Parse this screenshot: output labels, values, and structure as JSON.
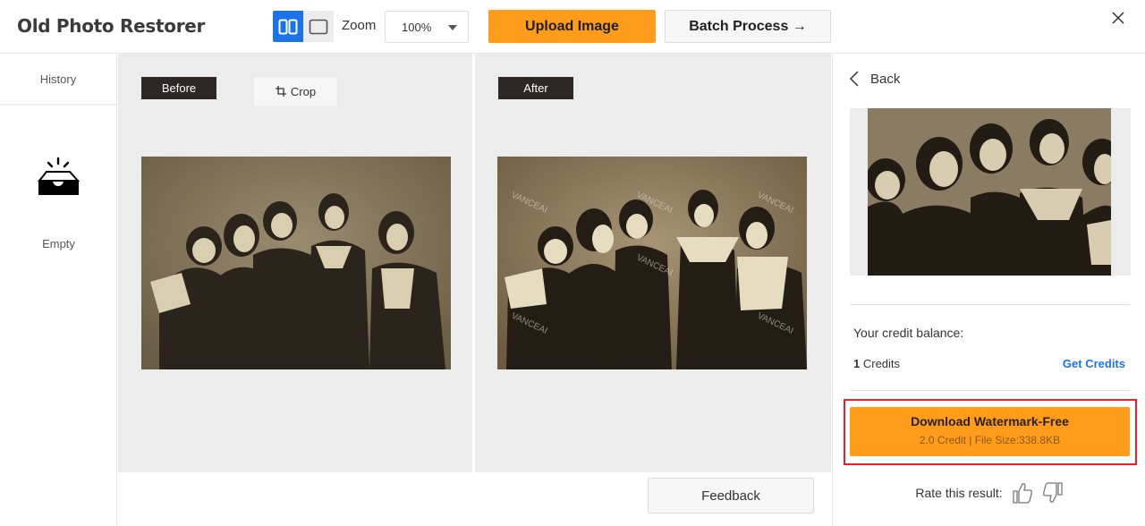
{
  "header": {
    "app_title": "Old Photo Restorer",
    "view_modes": [
      {
        "name": "split-view",
        "active": true
      },
      {
        "name": "single-view",
        "active": false
      }
    ],
    "zoom_label": "Zoom",
    "zoom_value": "100%",
    "upload_button": "Upload Image",
    "batch_button": "Batch Process →",
    "close_icon": "close-icon"
  },
  "sidebar": {
    "history_tab": "History",
    "empty_icon": "empty-inbox-icon",
    "empty_label": "Empty"
  },
  "compare": {
    "before_label": "Before",
    "crop_label": "Crop",
    "after_label": "After",
    "watermark_text": "VANCEAI"
  },
  "footer": {
    "feedback_button": "Feedback"
  },
  "right_panel": {
    "back_label": "Back",
    "credit_balance_title": "Your credit balance:",
    "credit_amount": "1",
    "credit_unit": " Credits",
    "get_credits_link": "Get Credits",
    "download_title": "Download Watermark-Free",
    "download_subtitle": "2.0 Credit | File Size:338.8KB",
    "rate_label": "Rate this result:",
    "rate_icons": [
      "thumbs-up-icon",
      "thumbs-down-icon"
    ]
  },
  "colors": {
    "accent_orange": "#ff9c1c",
    "primary_blue": "#1a73e8",
    "highlight_red": "#e8202a",
    "tag_dark": "#2d2625"
  }
}
